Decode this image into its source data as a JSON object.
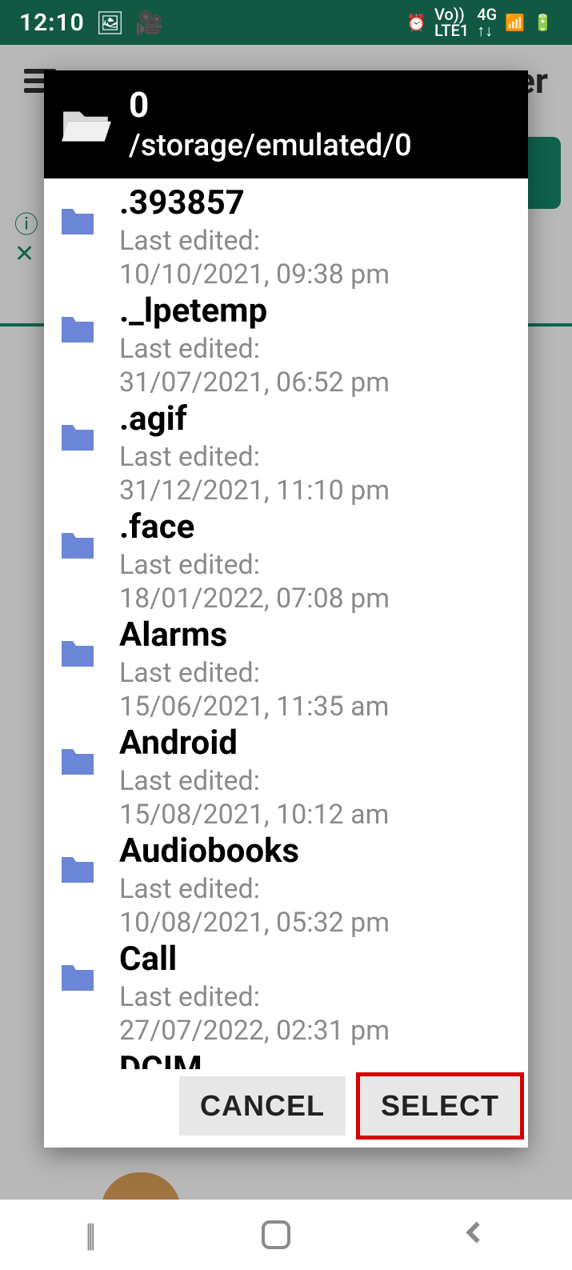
{
  "status_bar": {
    "time": "12:10",
    "icons": {
      "image": "🖼",
      "video": "🎥",
      "alarm": "⏰",
      "volte": "Vo))",
      "lte": "LTE1",
      "net": "4G",
      "updown": "↑↓",
      "signal": "📶",
      "battery": "🔋"
    }
  },
  "background_app": {
    "title_suffix": "er"
  },
  "dialog": {
    "current_folder": "0",
    "current_path": "/storage/emulated/0",
    "last_edited_label": "Last edited:",
    "items": [
      {
        "name": ".393857",
        "date": "10/10/2021, 09:38 pm"
      },
      {
        "name": "._lpetemp",
        "date": "31/07/2021, 06:52 pm"
      },
      {
        "name": ".agif",
        "date": "31/12/2021, 11:10 pm"
      },
      {
        "name": ".face",
        "date": "18/01/2022, 07:08 pm"
      },
      {
        "name": "Alarms",
        "date": "15/06/2021, 11:35 am"
      },
      {
        "name": "Android",
        "date": "15/08/2021, 10:12 am"
      },
      {
        "name": "Audiobooks",
        "date": "10/08/2021, 05:32 pm"
      },
      {
        "name": "Call",
        "date": "27/07/2022, 02:31 pm"
      },
      {
        "name": "DCIM",
        "date": ""
      }
    ],
    "buttons": {
      "cancel": "CANCEL",
      "select": "SELECT"
    }
  }
}
